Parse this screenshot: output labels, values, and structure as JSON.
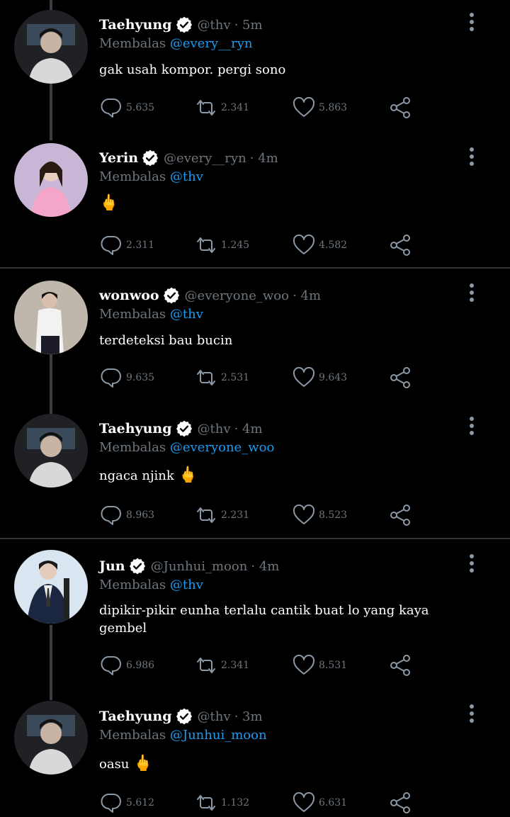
{
  "tweets": [
    {
      "name": "Taehyung",
      "handle": "@thv",
      "time": "· 5m",
      "replying_prefix": "Membalas",
      "mention": "@every__ryn",
      "text": "gak usah kompor. pergi sono",
      "emoji": "",
      "replies": "5.635",
      "retweets": "2.341",
      "likes": "5.863"
    },
    {
      "name": "Yerin",
      "handle": "@every__ryn",
      "time": "· 4m",
      "replying_prefix": "Membalas",
      "mention": "@thv",
      "text": "",
      "emoji": "🖕",
      "replies": "2.311",
      "retweets": "1.245",
      "likes": "4.582"
    },
    {
      "name": "wonwoo",
      "handle": "@everyone_woo",
      "time": "· 4m",
      "replying_prefix": "Membalas",
      "mention": "@thv",
      "text": "terdeteksi bau bucin",
      "emoji": "",
      "replies": "9.635",
      "retweets": "2.531",
      "likes": "9.643"
    },
    {
      "name": "Taehyung",
      "handle": "@thv",
      "time": "· 4m",
      "replying_prefix": "Membalas",
      "mention": "@everyone_woo",
      "text": "ngaca njink",
      "emoji": "🖕",
      "replies": "8.963",
      "retweets": "2.231",
      "likes": "8.523"
    },
    {
      "name": "Jun",
      "handle": "@Junhui_moon",
      "time": "· 4m",
      "replying_prefix": "Membalas",
      "mention": "@thv",
      "text": "dipikir-pikir eunha terlalu cantik buat lo yang kaya gembel",
      "emoji": "",
      "replies": "6.986",
      "retweets": "2.341",
      "likes": "8.531"
    },
    {
      "name": "Taehyung",
      "handle": "@thv",
      "time": "· 3m",
      "replying_prefix": "Membalas",
      "mention": "@Junhui_moon",
      "text": "oasu",
      "emoji": "🖕",
      "replies": "5.612",
      "retweets": "1.132",
      "likes": "6.631"
    }
  ],
  "icons": {
    "reply": "reply-icon",
    "retweet": "retweet-icon",
    "like": "heart-icon",
    "share": "share-icon",
    "more": "more-vertical-icon",
    "verified": "verified-badge-icon"
  },
  "colors": {
    "background": "#000000",
    "muted": "#6e767d",
    "mention": "#1d9bf0",
    "divider": "#2f3336"
  }
}
